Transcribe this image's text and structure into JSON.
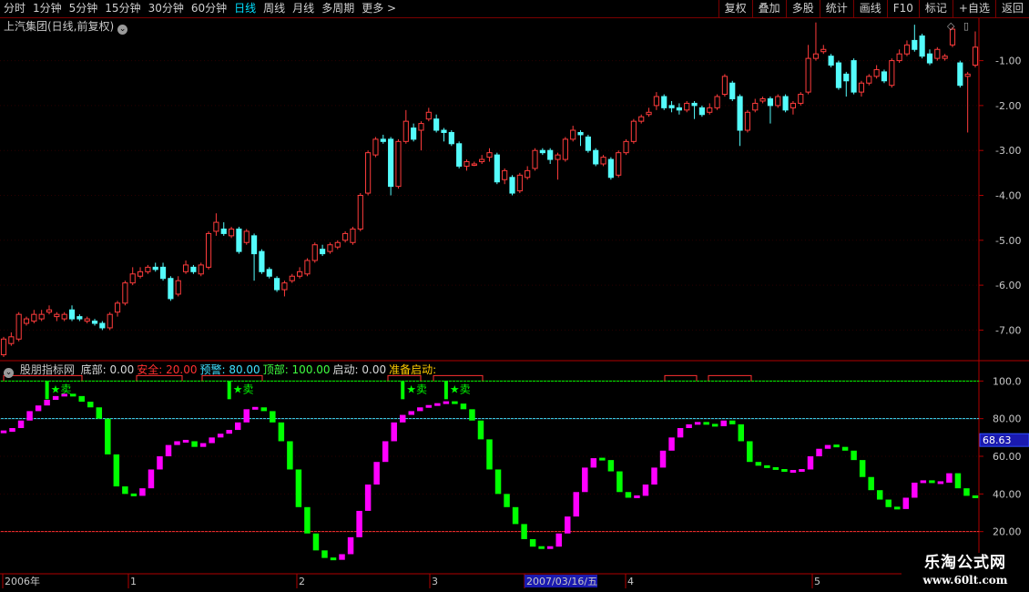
{
  "toolbar": {
    "left": [
      {
        "label": "分时",
        "active": false
      },
      {
        "label": "1分钟",
        "active": false
      },
      {
        "label": "5分钟",
        "active": false
      },
      {
        "label": "15分钟",
        "active": false
      },
      {
        "label": "30分钟",
        "active": false
      },
      {
        "label": "60分钟",
        "active": false
      },
      {
        "label": "日线",
        "active": true
      },
      {
        "label": "周线",
        "active": false
      },
      {
        "label": "月线",
        "active": false
      },
      {
        "label": "多周期",
        "active": false
      },
      {
        "label": "更多 >",
        "active": false
      }
    ],
    "right": [
      "复权",
      "叠加",
      "多股",
      "统计",
      "画线",
      "F10",
      "标记",
      "+自选",
      "返回"
    ]
  },
  "main_title": "上汽集团(日线,前复权)",
  "price_axis": [
    "-1.00",
    "-2.00",
    "-3.00",
    "-4.00",
    "-5.00",
    "-6.00",
    "-7.00"
  ],
  "indicator": {
    "name": "股朋指标网",
    "items": [
      {
        "label": "底部:",
        "value": "0.00",
        "color": "#d8d8d8"
      },
      {
        "label": "安全:",
        "value": "20.00",
        "color": "#ff3030"
      },
      {
        "label": "预警:",
        "value": "80.00",
        "color": "#40e0ff"
      },
      {
        "label": "顶部:",
        "value": "100.00",
        "color": "#40ff40"
      },
      {
        "label": "启动:",
        "value": "0.00",
        "color": "#d8d8d8"
      },
      {
        "label": "准备启动:",
        "value": "",
        "color": "#ffcc00"
      }
    ],
    "axis": [
      "100.0",
      "80.00",
      "60.00",
      "40.00",
      "20.00"
    ],
    "current_value": "68.63",
    "sell_label": "★卖"
  },
  "date_axis": [
    "2006年",
    "1",
    "2",
    "3",
    "2007/03/16/五",
    "4",
    "5"
  ],
  "watermark": {
    "line1": "乐淘公式网",
    "line2": "www.60lt.com"
  },
  "colors": {
    "up": "#ff3c3c",
    "down": "#54fcfc",
    "magenta": "#ff00ff",
    "green": "#00ff00",
    "frame": "#b00000"
  },
  "chart_data": {
    "type": "candlestick",
    "price_ylim": [
      -7.6,
      -0.4
    ],
    "candles": [
      [
        -7.55,
        -7.2,
        -7.6,
        -7.15
      ],
      [
        -7.3,
        -7.15,
        -7.35,
        -7.05
      ],
      [
        -7.2,
        -6.65,
        -7.25,
        -6.6
      ],
      [
        -6.85,
        -6.75,
        -6.9,
        -6.7
      ],
      [
        -6.8,
        -6.65,
        -6.85,
        -6.55
      ],
      [
        -6.75,
        -6.65,
        -6.8,
        -6.55
      ],
      [
        -6.6,
        -6.55,
        -6.65,
        -6.45
      ],
      [
        -6.7,
        -6.65,
        -6.8,
        -6.6
      ],
      [
        -6.75,
        -6.65,
        -6.8,
        -6.6
      ],
      [
        -6.55,
        -6.75,
        -6.8,
        -6.45
      ],
      [
        -6.7,
        -6.75,
        -6.8,
        -6.65
      ],
      [
        -6.8,
        -6.75,
        -6.85,
        -6.7
      ],
      [
        -6.8,
        -6.85,
        -6.9,
        -6.75
      ],
      [
        -6.85,
        -6.95,
        -7.0,
        -6.8
      ],
      [
        -6.95,
        -6.65,
        -7.0,
        -6.6
      ],
      [
        -6.6,
        -6.4,
        -6.7,
        -6.35
      ],
      [
        -6.4,
        -5.95,
        -6.45,
        -5.9
      ],
      [
        -5.95,
        -5.75,
        -6.0,
        -5.6
      ],
      [
        -5.8,
        -5.7,
        -5.85,
        -5.6
      ],
      [
        -5.7,
        -5.6,
        -5.75,
        -5.55
      ],
      [
        -5.6,
        -5.65,
        -5.7,
        -5.5
      ],
      [
        -5.6,
        -5.85,
        -5.9,
        -5.5
      ],
      [
        -5.85,
        -6.3,
        -6.35,
        -5.8
      ],
      [
        -6.2,
        -5.9,
        -6.25,
        -5.8
      ],
      [
        -5.7,
        -5.55,
        -5.75,
        -5.45
      ],
      [
        -5.6,
        -5.7,
        -5.75,
        -5.55
      ],
      [
        -5.75,
        -5.55,
        -5.8,
        -5.5
      ],
      [
        -5.6,
        -4.85,
        -5.65,
        -4.8
      ],
      [
        -4.8,
        -4.6,
        -4.9,
        -4.4
      ],
      [
        -4.75,
        -4.85,
        -4.9,
        -4.6
      ],
      [
        -4.9,
        -4.75,
        -4.95,
        -4.7
      ],
      [
        -4.75,
        -5.25,
        -5.3,
        -4.7
      ],
      [
        -5.05,
        -4.8,
        -5.1,
        -4.75
      ],
      [
        -4.9,
        -5.3,
        -5.9,
        -4.85
      ],
      [
        -5.25,
        -5.7,
        -5.75,
        -5.2
      ],
      [
        -5.65,
        -5.8,
        -5.85,
        -5.6
      ],
      [
        -5.85,
        -6.1,
        -6.15,
        -5.8
      ],
      [
        -6.1,
        -5.95,
        -6.25,
        -5.9
      ],
      [
        -5.9,
        -5.8,
        -5.95,
        -5.75
      ],
      [
        -5.8,
        -5.7,
        -5.85,
        -5.6
      ],
      [
        -5.75,
        -5.45,
        -5.8,
        -5.4
      ],
      [
        -5.45,
        -5.1,
        -5.5,
        -5.05
      ],
      [
        -5.2,
        -5.3,
        -5.35,
        -5.1
      ],
      [
        -5.25,
        -5.1,
        -5.3,
        -5.05
      ],
      [
        -5.15,
        -5.05,
        -5.2,
        -5.0
      ],
      [
        -5.0,
        -4.85,
        -5.05,
        -4.8
      ],
      [
        -5.05,
        -4.75,
        -5.1,
        -4.7
      ],
      [
        -4.75,
        -4.0,
        -4.8,
        -3.95
      ],
      [
        -3.95,
        -3.05,
        -4.0,
        -3.0
      ],
      [
        -3.1,
        -2.75,
        -3.15,
        -2.7
      ],
      [
        -2.75,
        -2.8,
        -2.85,
        -2.65
      ],
      [
        -2.75,
        -3.8,
        -4.0,
        -2.7
      ],
      [
        -3.8,
        -2.8,
        -3.85,
        -2.75
      ],
      [
        -2.8,
        -2.35,
        -2.85,
        -2.1
      ],
      [
        -2.5,
        -2.75,
        -2.8,
        -2.4
      ],
      [
        -2.55,
        -2.4,
        -3.0,
        -2.35
      ],
      [
        -2.3,
        -2.15,
        -2.35,
        -2.05
      ],
      [
        -2.3,
        -2.55,
        -2.6,
        -2.2
      ],
      [
        -2.55,
        -2.6,
        -2.8,
        -2.5
      ],
      [
        -2.6,
        -2.85,
        -2.9,
        -2.55
      ],
      [
        -2.85,
        -3.35,
        -3.4,
        -2.8
      ],
      [
        -3.35,
        -3.25,
        -3.45,
        -3.2
      ],
      [
        -3.3,
        -3.3,
        -3.35,
        -3.25
      ],
      [
        -3.25,
        -3.2,
        -3.3,
        -3.1
      ],
      [
        -3.15,
        -3.05,
        -3.25,
        -2.95
      ],
      [
        -3.1,
        -3.7,
        -3.75,
        -3.05
      ],
      [
        -3.65,
        -3.45,
        -3.75,
        -3.4
      ],
      [
        -3.6,
        -3.95,
        -4.0,
        -3.55
      ],
      [
        -3.9,
        -3.55,
        -3.95,
        -3.5
      ],
      [
        -3.6,
        -3.45,
        -3.65,
        -3.35
      ],
      [
        -3.4,
        -3.0,
        -3.45,
        -2.95
      ],
      [
        -3.0,
        -3.05,
        -3.1,
        -2.95
      ],
      [
        -3.0,
        -3.2,
        -3.3,
        -2.95
      ],
      [
        -3.2,
        -3.1,
        -3.65,
        -3.05
      ],
      [
        -3.2,
        -2.75,
        -3.25,
        -2.7
      ],
      [
        -2.75,
        -2.55,
        -2.8,
        -2.45
      ],
      [
        -2.6,
        -2.65,
        -2.9,
        -2.55
      ],
      [
        -2.7,
        -3.0,
        -3.05,
        -2.65
      ],
      [
        -3.0,
        -3.3,
        -3.35,
        -2.95
      ],
      [
        -3.3,
        -3.15,
        -3.35,
        -3.1
      ],
      [
        -3.2,
        -3.6,
        -3.65,
        -3.15
      ],
      [
        -3.55,
        -3.05,
        -3.6,
        -3.0
      ],
      [
        -3.05,
        -2.8,
        -3.1,
        -2.75
      ],
      [
        -2.8,
        -2.35,
        -2.85,
        -2.3
      ],
      [
        -2.35,
        -2.25,
        -2.4,
        -2.2
      ],
      [
        -2.2,
        -2.15,
        -2.25,
        -2.05
      ],
      [
        -2.0,
        -1.8,
        -2.1,
        -1.7
      ],
      [
        -1.8,
        -2.05,
        -2.1,
        -1.75
      ],
      [
        -2.0,
        -2.05,
        -2.15,
        -1.9
      ],
      [
        -2.05,
        -2.1,
        -2.2,
        -1.95
      ],
      [
        -2.1,
        -1.95,
        -2.15,
        -1.9
      ],
      [
        -1.95,
        -2.0,
        -2.3,
        -1.9
      ],
      [
        -2.05,
        -2.2,
        -2.25,
        -2.0
      ],
      [
        -2.15,
        -2.05,
        -2.2,
        -1.95
      ],
      [
        -2.05,
        -1.8,
        -2.1,
        -1.75
      ],
      [
        -1.75,
        -1.35,
        -1.8,
        -1.3
      ],
      [
        -1.5,
        -1.85,
        -1.9,
        -1.45
      ],
      [
        -1.8,
        -2.55,
        -2.9,
        -1.75
      ],
      [
        -2.55,
        -2.15,
        -2.6,
        -2.1
      ],
      [
        -2.1,
        -1.95,
        -2.15,
        -1.85
      ],
      [
        -1.9,
        -1.85,
        -1.95,
        -1.8
      ],
      [
        -1.85,
        -2.0,
        -2.4,
        -1.8
      ],
      [
        -2.0,
        -1.8,
        -2.05,
        -1.75
      ],
      [
        -1.8,
        -2.1,
        -2.15,
        -1.75
      ],
      [
        -2.05,
        -1.95,
        -2.2,
        -1.9
      ],
      [
        -1.95,
        -1.75,
        -2.0,
        -1.7
      ],
      [
        -1.7,
        -0.95,
        -1.75,
        -0.65
      ],
      [
        -0.95,
        -0.85,
        -1.0,
        -0.15
      ],
      [
        -0.8,
        -0.75,
        -0.85,
        -0.65
      ],
      [
        -0.9,
        -1.1,
        -1.15,
        -0.85
      ],
      [
        -1.05,
        -1.6,
        -1.65,
        -1.0
      ],
      [
        -1.3,
        -1.45,
        -1.8,
        -1.25
      ],
      [
        -1.0,
        -1.7,
        -1.75,
        -0.95
      ],
      [
        -1.7,
        -1.5,
        -1.8,
        -1.45
      ],
      [
        -1.5,
        -1.35,
        -1.55,
        -1.3
      ],
      [
        -1.35,
        -1.2,
        -1.4,
        -1.1
      ],
      [
        -1.25,
        -1.45,
        -1.5,
        -1.2
      ],
      [
        -1.55,
        -1.0,
        -1.6,
        -0.95
      ],
      [
        -1.0,
        -0.85,
        -1.05,
        -0.75
      ],
      [
        -0.85,
        -0.65,
        -0.9,
        -0.55
      ],
      [
        -0.55,
        -0.75,
        -0.8,
        -0.2
      ],
      [
        -0.45,
        -0.9,
        -0.95,
        -0.4
      ],
      [
        -0.85,
        -1.05,
        -1.1,
        -0.75
      ],
      [
        -0.95,
        -0.75,
        -1.0,
        -0.7
      ],
      [
        -0.95,
        -0.9,
        -1.0,
        -0.85
      ],
      [
        -0.65,
        -0.3,
        -0.7,
        -0.25
      ],
      [
        -1.05,
        -1.55,
        -1.6,
        -1.0
      ],
      [
        -1.35,
        -1.3,
        -2.6,
        -1.25
      ],
      [
        -1.1,
        -0.7,
        -1.15,
        -0.35
      ]
    ],
    "indicator_ylim": [
      0,
      105
    ],
    "indicator_values": [
      73,
      75,
      79,
      84,
      87,
      90,
      92,
      93,
      92,
      89,
      86,
      80,
      61,
      44,
      40,
      39,
      43,
      53,
      60,
      66,
      68,
      68,
      65,
      67,
      70,
      72,
      74,
      78,
      85,
      86,
      84,
      78,
      68,
      53,
      33,
      19,
      10,
      6,
      5,
      8,
      17,
      31,
      45,
      57,
      68,
      78,
      82,
      84,
      86,
      87,
      88,
      89,
      88,
      85,
      79,
      69,
      53,
      40,
      33,
      24,
      16,
      12,
      11,
      12,
      19,
      28,
      41,
      54,
      59,
      58,
      52,
      41,
      38,
      39,
      45,
      54,
      63,
      70,
      75,
      77,
      78,
      77,
      76,
      79,
      77,
      68,
      57,
      55,
      54,
      53,
      52,
      52,
      53,
      60,
      64,
      66,
      65,
      63,
      58,
      49,
      42,
      37,
      33,
      32,
      38,
      46,
      47,
      46,
      46,
      51,
      43,
      39,
      38
    ],
    "sell_at": [
      5,
      26,
      46,
      51
    ],
    "ref_lines": [
      20,
      80,
      100
    ]
  }
}
